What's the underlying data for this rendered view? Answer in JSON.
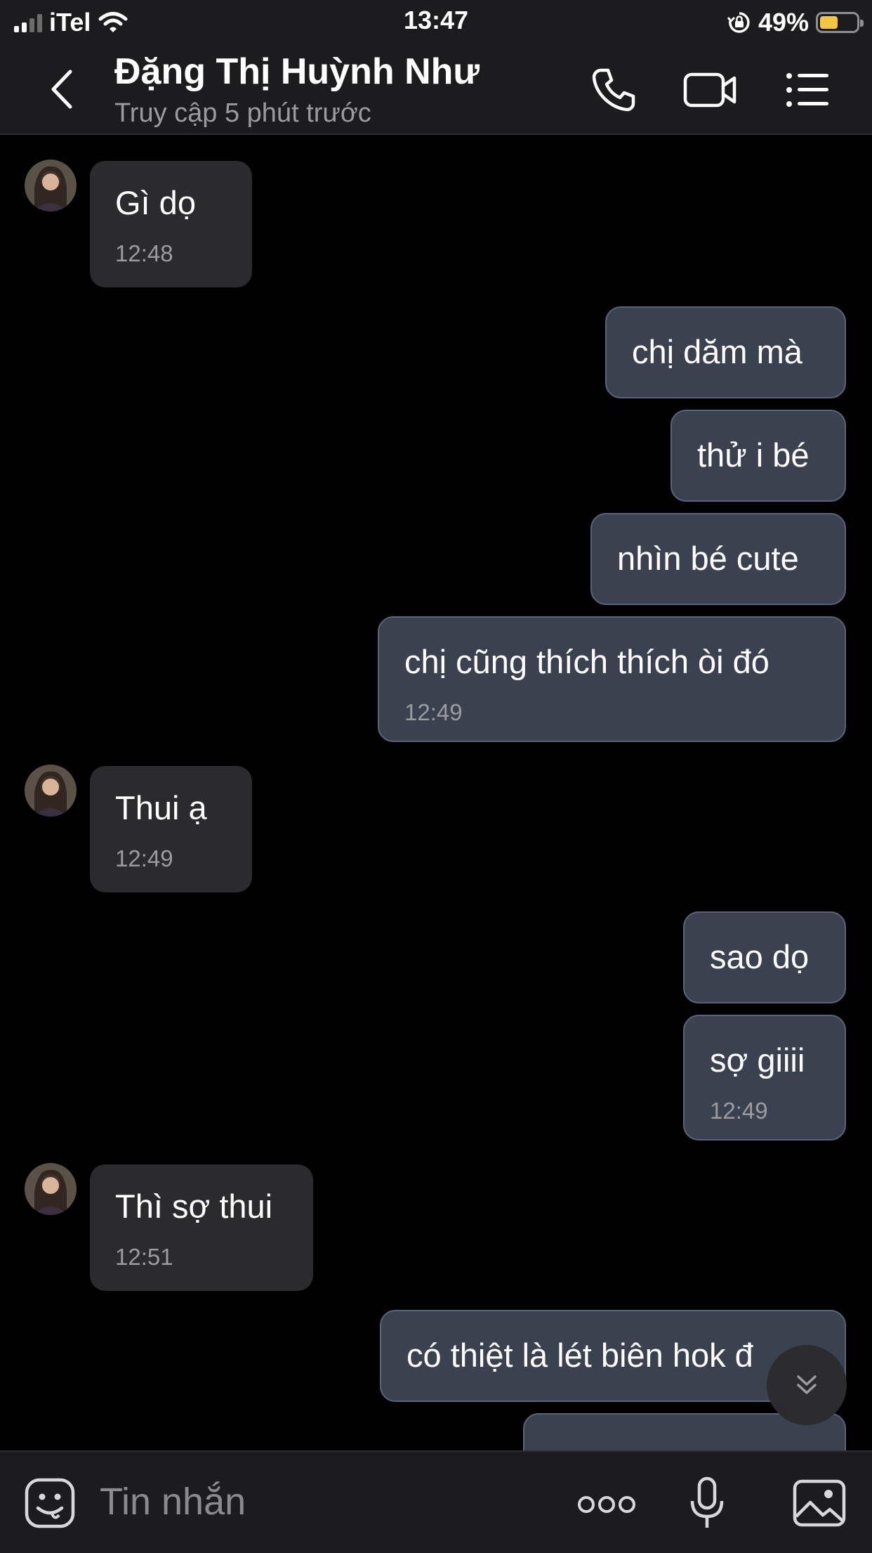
{
  "status_bar": {
    "carrier": "iTel",
    "time": "13:47",
    "battery": "49%",
    "battery_level": 0.49
  },
  "header": {
    "contact_name": "Đặng Thị Huỳnh Như",
    "last_seen": "Truy cập 5 phút trước"
  },
  "messages": [
    {
      "text": "Gì dọ",
      "time": "12:48"
    },
    {
      "text": "chị dăm mà"
    },
    {
      "text": "thử i bé"
    },
    {
      "text": "nhìn bé cute"
    },
    {
      "text": "chị cũng thích thích òi đó",
      "time": "12:49"
    },
    {
      "text": "Thui ạ",
      "time": "12:49"
    },
    {
      "text": "sao dọ"
    },
    {
      "text": "sợ giiii",
      "time": "12:49"
    },
    {
      "text": "Thì sợ thui",
      "time": "12:51"
    },
    {
      "text": "có thiệt là lét biên hok đ"
    }
  ],
  "input": {
    "placeholder": "Tin nhắn"
  },
  "icons": {
    "back": "chevron-left-icon",
    "call": "phone-icon",
    "video": "video-camera-icon",
    "menu": "list-menu-icon",
    "emoji": "emoji-sticker-icon",
    "more": "more-dots-icon",
    "mic": "microphone-icon",
    "gallery": "image-gallery-icon",
    "scroll": "double-chevron-down-icon"
  },
  "colors": {
    "background": "#000000",
    "incoming_bubble": "#2b2b2d",
    "outgoing_bubble": "#3a4250",
    "outgoing_border": "#58647a"
  }
}
